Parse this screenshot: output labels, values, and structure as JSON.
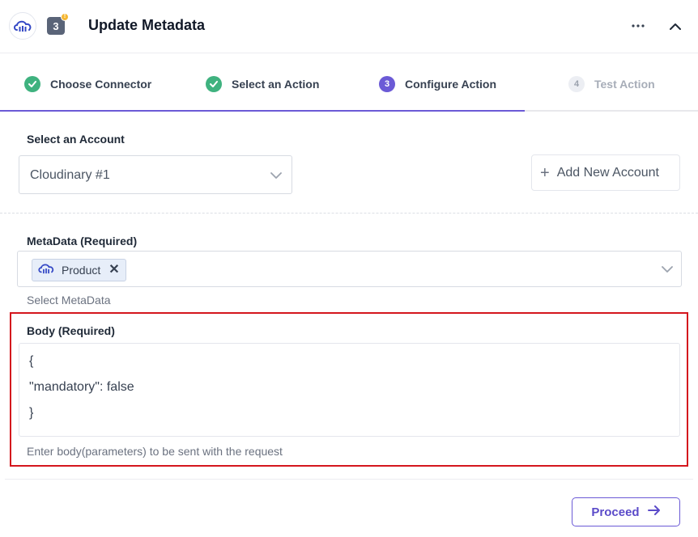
{
  "header": {
    "title": "Update Metadata",
    "step_number": "3",
    "notification_dot": "!",
    "icons": {
      "logo": "cloudinary-logo-icon",
      "more": "more-dots-icon",
      "collapse": "chevron-up-icon"
    }
  },
  "stepper": {
    "steps": [
      {
        "label": "Choose Connector",
        "status": "done",
        "marker": "✓"
      },
      {
        "label": "Select an Action",
        "status": "done",
        "marker": "✓"
      },
      {
        "label": "Configure Action",
        "status": "current",
        "marker": "3"
      },
      {
        "label": "Test Action",
        "status": "pending",
        "marker": "4"
      }
    ]
  },
  "account": {
    "label": "Select an Account",
    "selected": "Cloudinary #1",
    "add_button": "Add New Account"
  },
  "metadata": {
    "label": "MetaData (Required)",
    "chip": "Product",
    "helper": "Select MetaData"
  },
  "body": {
    "label": "Body (Required)",
    "lines": [
      "{",
      "\"mandatory\": false",
      "}"
    ],
    "helper": "Enter body(parameters) to be sent with the request"
  },
  "footer": {
    "proceed": "Proceed"
  },
  "colors": {
    "accent": "#6b5ad6",
    "success": "#3fb27f",
    "highlight": "#d4161d"
  }
}
